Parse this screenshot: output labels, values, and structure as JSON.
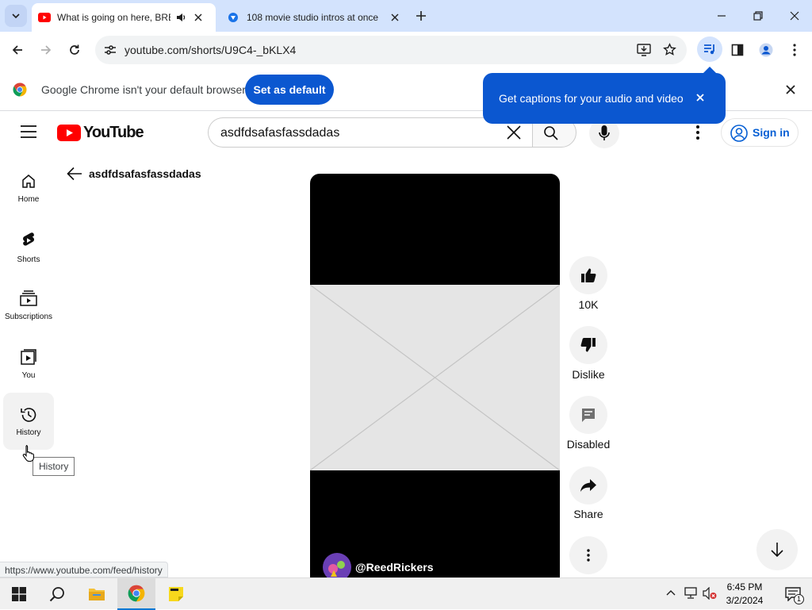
{
  "browser": {
    "tabs": [
      {
        "title": "What is going on here, BRE",
        "favicon": "youtube-favicon",
        "active": true,
        "audio": true
      },
      {
        "title": "108 movie studio intros at once",
        "favicon": "site-favicon",
        "active": false
      }
    ],
    "url": "youtube.com/shorts/U9C4-_bKLX4",
    "status_url": "https://www.youtube.com/feed/history"
  },
  "infobar": {
    "message": "Google Chrome isn't your default browser",
    "button": "Set as default",
    "caption_bubble": "Get captions for your audio and video"
  },
  "youtube": {
    "logo_text": "YouTube",
    "search_value": "asdfdsafasfassdadas",
    "sign_in": "Sign in",
    "back_title": "asdfdsafasfassdadas",
    "sidebar": [
      {
        "label": "Home",
        "icon": "home-icon"
      },
      {
        "label": "Shorts",
        "icon": "shorts-icon"
      },
      {
        "label": "Subscriptions",
        "icon": "subscriptions-icon"
      },
      {
        "label": "You",
        "icon": "you-icon"
      },
      {
        "label": "History",
        "icon": "history-icon"
      }
    ],
    "tooltip": "History",
    "short": {
      "channel": "@ReedRickers",
      "likes": "10K",
      "dislike": "Dislike",
      "comments": "Disabled",
      "share": "Share"
    }
  },
  "taskbar": {
    "time": "6:45 PM",
    "date": "3/2/2024",
    "notification_count": "1"
  },
  "colors": {
    "chrome_tabstrip": "#d3e3fd",
    "chrome_blue": "#0b57d0",
    "youtube_red": "#ff0000",
    "link_blue": "#065fd4"
  }
}
